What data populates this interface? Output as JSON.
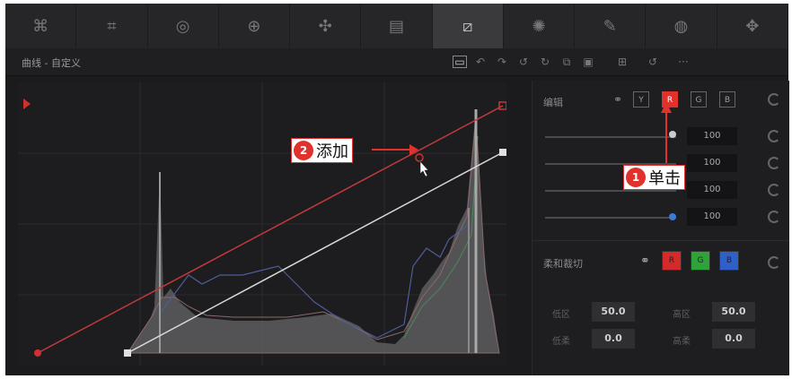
{
  "toolbar": {
    "items": [
      {
        "icon": "camera-raw-icon",
        "glyph": "⌘"
      },
      {
        "icon": "color-match-icon",
        "glyph": "⌗"
      },
      {
        "icon": "color-wheels-icon",
        "glyph": "◎"
      },
      {
        "icon": "hdr-icon",
        "glyph": "⊕"
      },
      {
        "icon": "rgb-mixer-icon",
        "glyph": "✣"
      },
      {
        "icon": "motion-effects-icon",
        "glyph": "▤"
      },
      {
        "icon": "curves-icon",
        "glyph": "⧄",
        "active": true
      },
      {
        "icon": "color-warper-icon",
        "glyph": "✺"
      },
      {
        "icon": "qualifier-icon",
        "glyph": "✎"
      },
      {
        "icon": "window-icon",
        "glyph": "◍"
      },
      {
        "icon": "tracker-icon",
        "glyph": "✥"
      }
    ]
  },
  "header": {
    "title": "曲线 - 自定义",
    "icons": [
      "edit-mode-icon",
      "back-icon",
      "forward-icon",
      "undo-icon",
      "redo-icon",
      "copy-icon",
      "paste-icon",
      "grid-icon",
      "reset-all-icon",
      "more-icon"
    ],
    "more_label": "···"
  },
  "side": {
    "edit_label": "编辑",
    "channels": [
      "Y",
      "R",
      "G",
      "B"
    ],
    "selected_channel": "R",
    "sliders": [
      {
        "value": "100",
        "color": "#cccccc"
      },
      {
        "value": "100",
        "color": "#cccccc"
      },
      {
        "value": "100",
        "color": "#cccccc"
      },
      {
        "value": "100",
        "color": "#3a7bd5"
      }
    ],
    "soft_clip_label": "柔和裁切",
    "swatches": [
      {
        "label": "R",
        "color": "#d42a2a"
      },
      {
        "label": "G",
        "color": "#2fa33a"
      },
      {
        "label": "B",
        "color": "#2f5fc9"
      }
    ],
    "fields": [
      {
        "label": "低区",
        "value": "50.0"
      },
      {
        "label": "高区",
        "value": "50.0"
      },
      {
        "label": "低柔",
        "value": "0.0"
      },
      {
        "label": "高柔",
        "value": "0.0"
      }
    ]
  },
  "callouts": [
    {
      "number": "2",
      "text": "添加"
    },
    {
      "number": "1",
      "text": "单击"
    }
  ],
  "colors": {
    "red_curve": "#c23a3a",
    "white_curve": "#d9d9d9",
    "accent": "#e0312c"
  }
}
